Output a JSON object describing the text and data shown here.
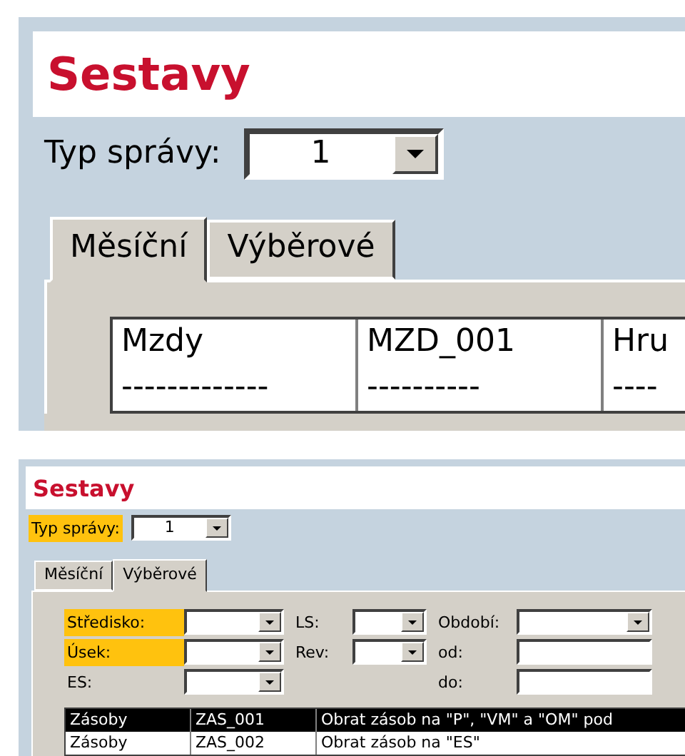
{
  "panels": [
    {
      "kind": "zoomed",
      "title": "Sestavy",
      "report_type": {
        "label": "Typ správy:",
        "highlighted": false,
        "value": "1"
      },
      "tabs": [
        {
          "label": "Měsíční",
          "selected": true
        },
        {
          "label": "Výběrové",
          "selected": false
        }
      ],
      "list": {
        "rows": [
          {
            "cells": [
              "Mzdy",
              "MZD_001",
              "Hru"
            ],
            "selected": false
          },
          {
            "cells": [
              "-------------",
              "----------",
              "----"
            ],
            "selected": false
          }
        ]
      }
    },
    {
      "kind": "normal",
      "title": "Sestavy",
      "report_type": {
        "label": "Typ správy:",
        "highlighted": true,
        "value": "1"
      },
      "tabs": [
        {
          "label": "Měsíční",
          "selected": false
        },
        {
          "label": "Výběrové",
          "selected": true
        }
      ],
      "filter_columns": [
        {
          "fields": [
            {
              "label": "Středisko:",
              "highlighted": true,
              "kind": "combo"
            },
            {
              "label": "Úsek:",
              "highlighted": true,
              "kind": "combo"
            },
            {
              "label": "ES:",
              "highlighted": false,
              "kind": "combo"
            }
          ]
        },
        {
          "fields": [
            {
              "label": "LS:",
              "highlighted": false,
              "kind": "combo"
            },
            {
              "label": "Rev:",
              "highlighted": false,
              "kind": "combo"
            }
          ]
        },
        {
          "fields": [
            {
              "label": "Období:",
              "highlighted": false,
              "kind": "combo"
            },
            {
              "label": "od:",
              "highlighted": false,
              "kind": "text"
            },
            {
              "label": "do:",
              "highlighted": false,
              "kind": "text"
            }
          ]
        }
      ],
      "list": {
        "rows": [
          {
            "cells": [
              "Zásoby",
              "ZAS_001",
              "Obrat zásob na \"P\", \"VM\" a \"OM\" pod"
            ],
            "selected": true
          },
          {
            "cells": [
              "Zásoby",
              "ZAS_002",
              "Obrat zásob na \"ES\""
            ],
            "selected": false
          }
        ]
      }
    }
  ]
}
